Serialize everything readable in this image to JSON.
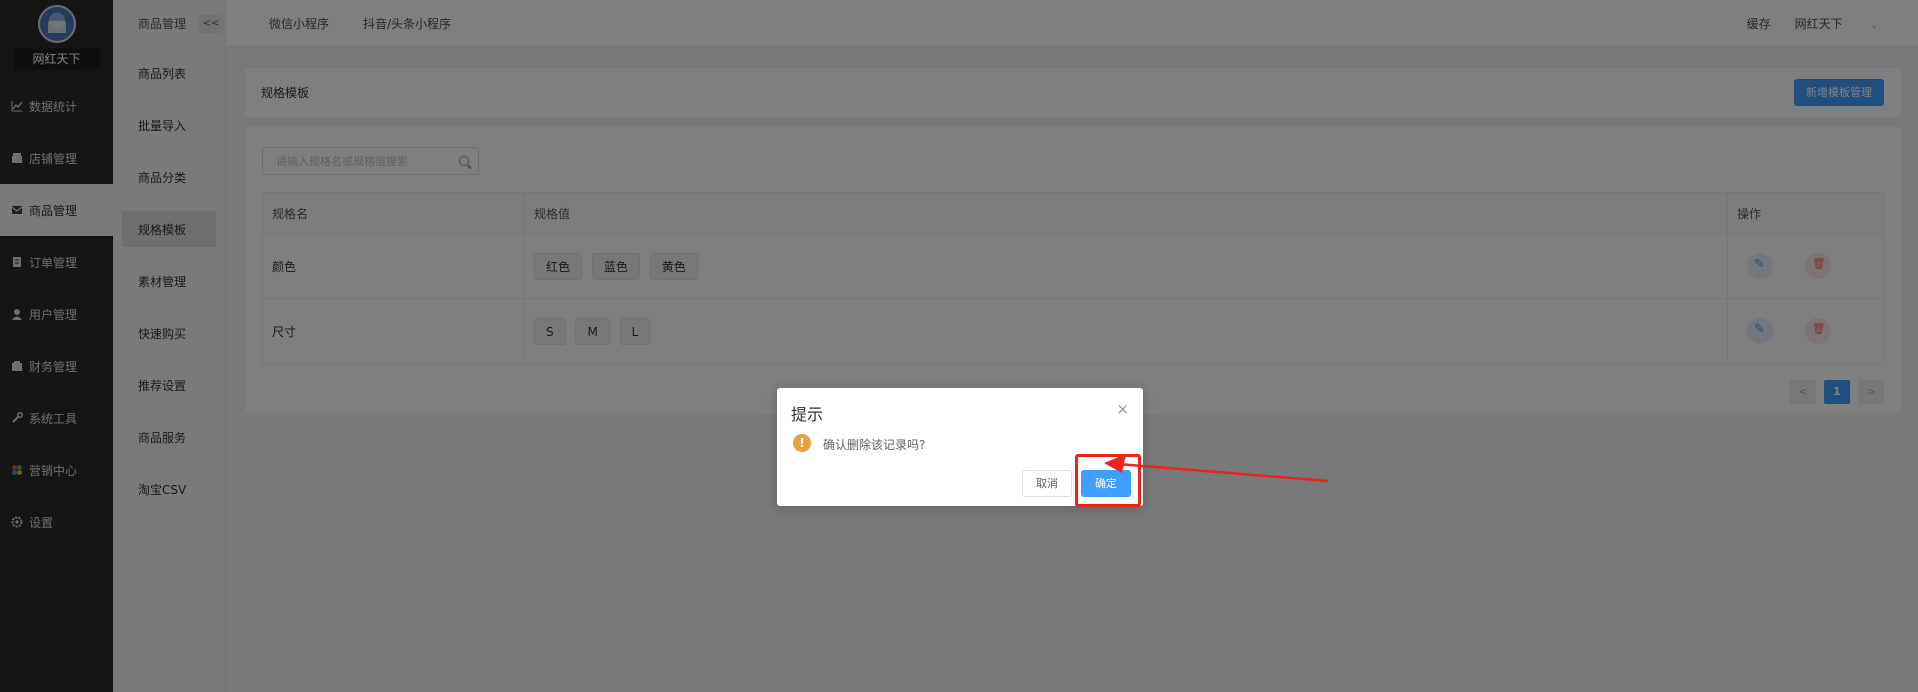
{
  "sidebar": {
    "store_name": "网红天下",
    "items": [
      {
        "label": "数据统计",
        "icon": "chart-icon"
      },
      {
        "label": "店铺管理",
        "icon": "store-icon"
      },
      {
        "label": "商品管理",
        "icon": "product-icon"
      },
      {
        "label": "订单管理",
        "icon": "order-icon"
      },
      {
        "label": "用户管理",
        "icon": "user-icon"
      },
      {
        "label": "财务管理",
        "icon": "finance-icon"
      },
      {
        "label": "系统工具",
        "icon": "wrench-icon"
      },
      {
        "label": "营销中心",
        "icon": "marketing-icon"
      },
      {
        "label": "设置",
        "icon": "gear-icon"
      }
    ],
    "active_index": 2
  },
  "subnav": {
    "title": "商品管理",
    "collapse_label": "<<",
    "items": [
      "商品列表",
      "批量导入",
      "商品分类",
      "规格模板",
      "素材管理",
      "快速购买",
      "推荐设置",
      "商品服务",
      "淘宝CSV"
    ],
    "active_index": 3
  },
  "topbar": {
    "tabs": [
      "微信小程序",
      "抖音/头条小程序"
    ],
    "cache_label": "缓存",
    "user_label": "网红天下"
  },
  "panel": {
    "title": "规格模板",
    "add_button": "新增模板管理"
  },
  "search": {
    "placeholder": "请输入规格名或规格值搜索"
  },
  "table": {
    "headers": [
      "规格名",
      "规格值",
      "操作"
    ],
    "rows": [
      {
        "name": "颜色",
        "values": [
          "红色",
          "蓝色",
          "黄色"
        ]
      },
      {
        "name": "尺寸",
        "values": [
          "S",
          "M",
          "L"
        ]
      }
    ]
  },
  "pagination": {
    "prev": "<",
    "current": "1",
    "next": ">"
  },
  "dialog": {
    "title": "提示",
    "close": "×",
    "warn_symbol": "!",
    "message": "确认删除该记录吗?",
    "cancel": "取消",
    "confirm": "确定"
  },
  "colors": {
    "primary": "#409eff",
    "warning": "#e6a23c",
    "danger": "#f56c6c",
    "annotation": "#e8261c",
    "sidebar_bg": "#2b2b2b"
  }
}
